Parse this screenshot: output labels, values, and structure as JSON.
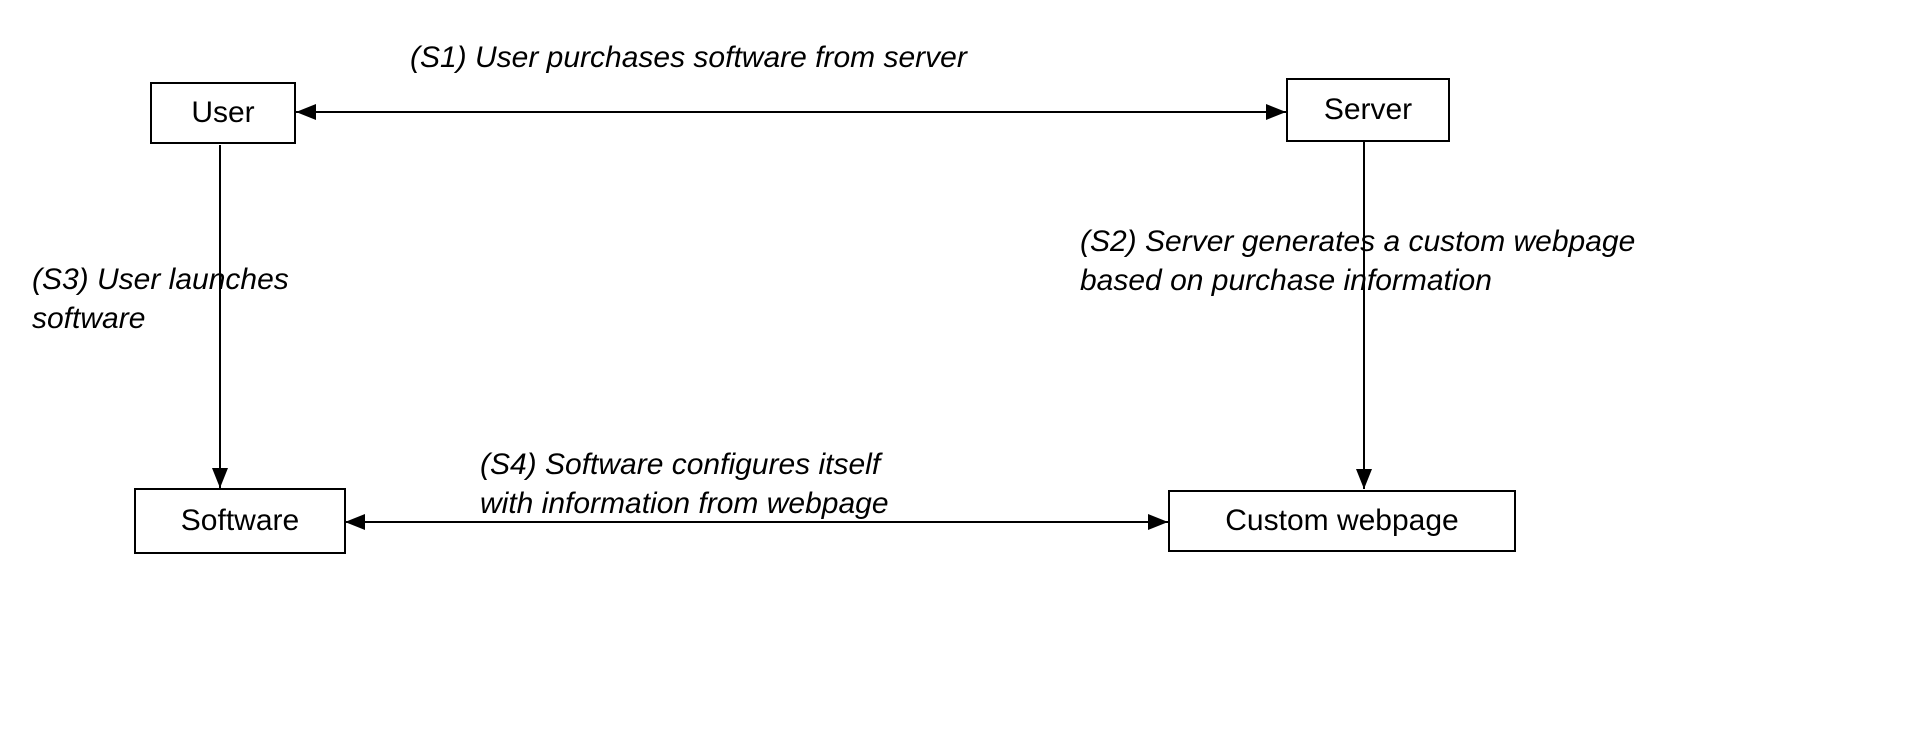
{
  "nodes": {
    "user": {
      "label": "User"
    },
    "server": {
      "label": "Server"
    },
    "software": {
      "label": "Software"
    },
    "webpage": {
      "label": "Custom webpage"
    }
  },
  "edges": {
    "s1": {
      "line1": "(S1) User purchases software from server"
    },
    "s2": {
      "line1": "(S2) Server generates a custom webpage",
      "line2": "based on purchase information"
    },
    "s3": {
      "line1": "(S3) User launches",
      "line2": "software"
    },
    "s4": {
      "line1": "(S4) Software configures itself",
      "line2": "with information from webpage"
    }
  }
}
